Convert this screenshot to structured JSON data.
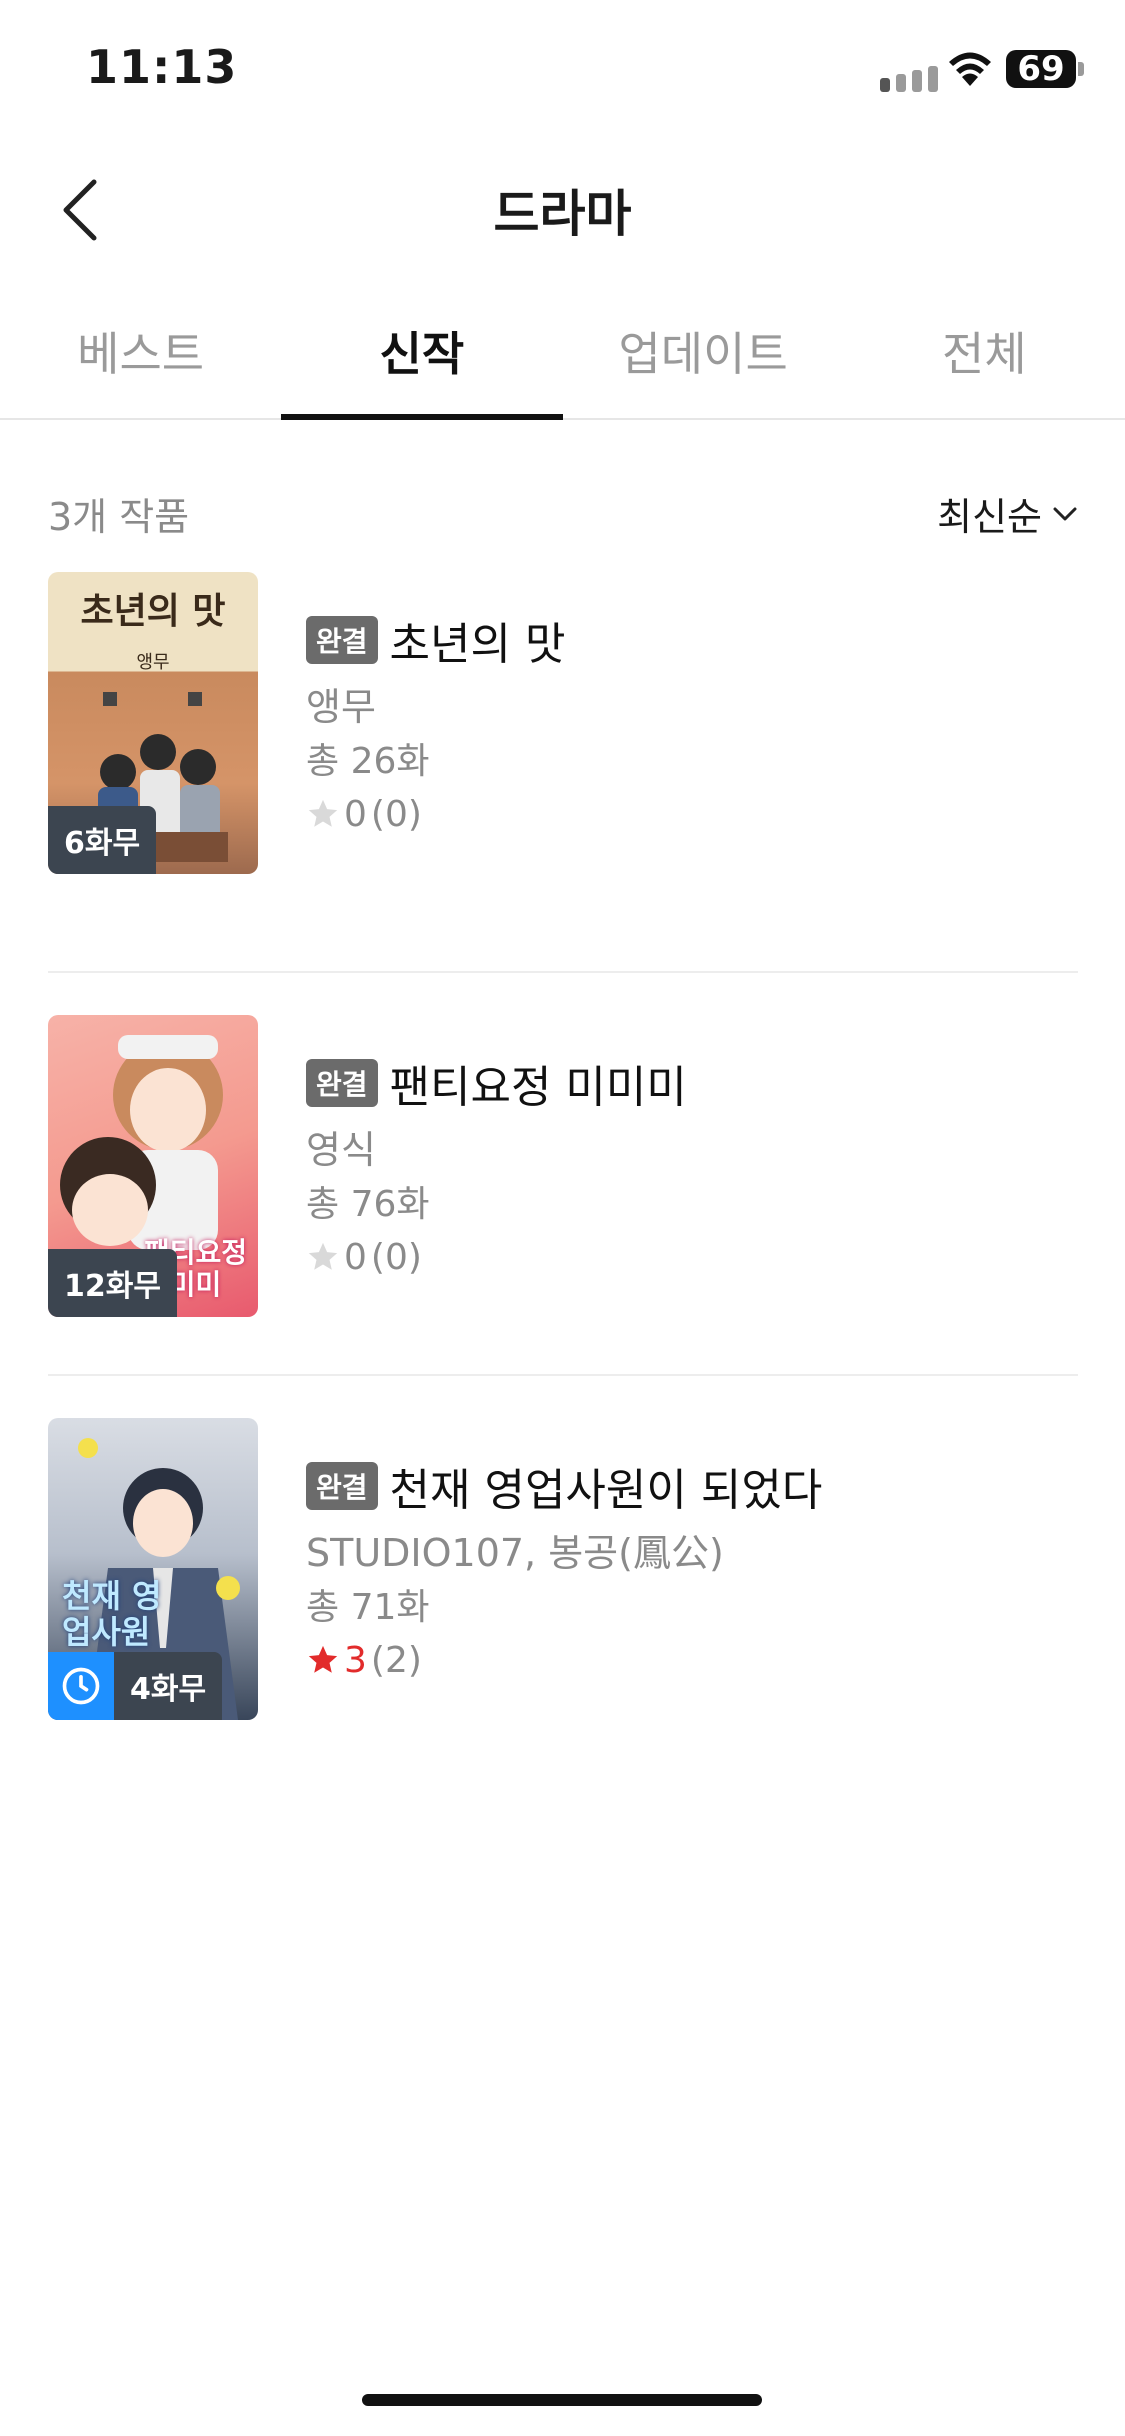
{
  "status_bar": {
    "time": "11:13",
    "battery": "69"
  },
  "header": {
    "title": "드라마"
  },
  "tabs": [
    {
      "label": "베스트",
      "active": false
    },
    {
      "label": "신작",
      "active": true
    },
    {
      "label": "업데이트",
      "active": false
    },
    {
      "label": "전체",
      "active": false
    }
  ],
  "list_header": {
    "count_text": "3개 작품",
    "sort_label": "최신순"
  },
  "items": [
    {
      "badge": "6화무",
      "status_tag": "완결",
      "title": "초년의 맛",
      "author": "앵무",
      "episodes": "총 26화",
      "rating": "0",
      "rating_count": "(0)",
      "star_color": "#d9d9d9",
      "cover_title": "초년의 맛",
      "cover_subtitle": "앵무",
      "clock": false
    },
    {
      "badge": "12화무",
      "status_tag": "완결",
      "title": "팬티요정 미미미",
      "author": "영식",
      "episodes": "총 76화",
      "rating": "0",
      "rating_count": "(0)",
      "star_color": "#d9d9d9",
      "cover_title": "팬티요정 미미미",
      "clock": false
    },
    {
      "badge": "4화무",
      "status_tag": "완결",
      "title": "천재 영업사원이 되었다",
      "author": "STUDIO107, 봉공(鳳公)",
      "episodes": "총 71화",
      "rating": "3",
      "rating_count": "(2)",
      "star_color": "#e22b2b",
      "cover_title": "천재 영업사원",
      "clock": true
    }
  ]
}
